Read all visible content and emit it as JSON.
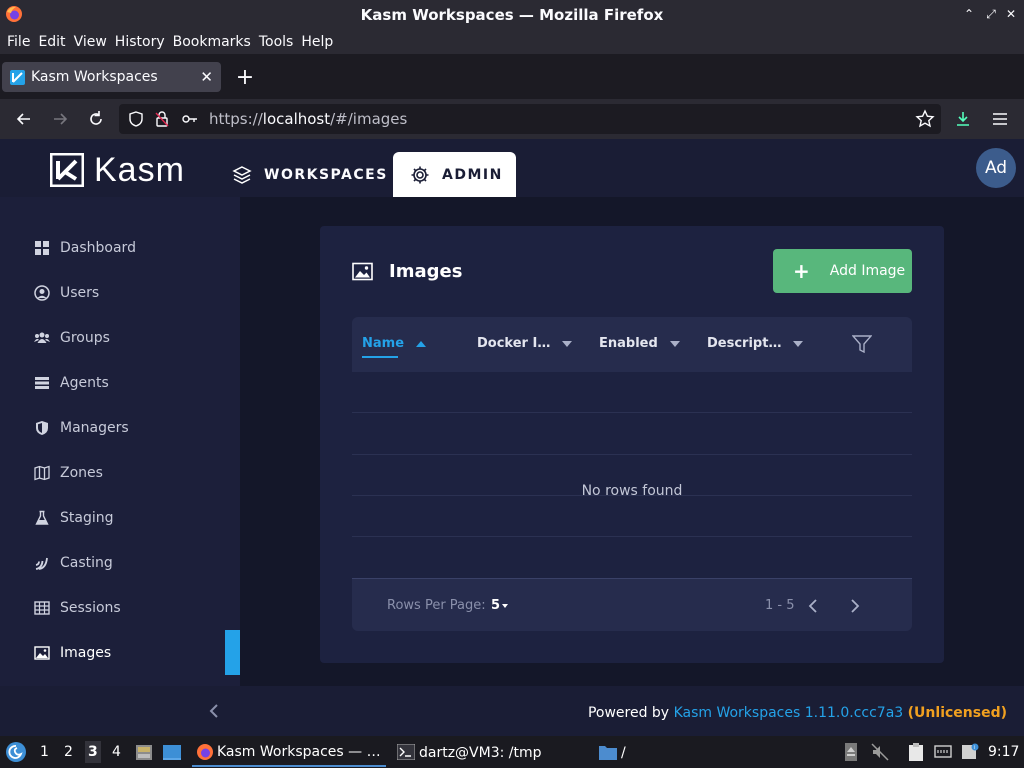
{
  "window": {
    "title": "Kasm Workspaces — Mozilla Firefox"
  },
  "menubar": {
    "items": [
      "File",
      "Edit",
      "View",
      "History",
      "Bookmarks",
      "Tools",
      "Help"
    ]
  },
  "tab": {
    "label": "Kasm Workspaces"
  },
  "url": {
    "prefix": "https://",
    "host": "localhost",
    "path": "/#/images"
  },
  "app": {
    "logo_text": "Kasm",
    "nav": {
      "workspaces": "WORKSPACES",
      "admin": "ADMIN"
    },
    "avatar": "Ad",
    "sidebar": {
      "items": [
        {
          "label": "Dashboard",
          "icon": "dashboard-icon"
        },
        {
          "label": "Users",
          "icon": "user-circle-icon"
        },
        {
          "label": "Groups",
          "icon": "users-icon"
        },
        {
          "label": "Agents",
          "icon": "server-icon"
        },
        {
          "label": "Managers",
          "icon": "shield-icon"
        },
        {
          "label": "Zones",
          "icon": "map-icon"
        },
        {
          "label": "Staging",
          "icon": "flask-icon"
        },
        {
          "label": "Casting",
          "icon": "cast-icon"
        },
        {
          "label": "Sessions",
          "icon": "table-icon"
        },
        {
          "label": "Images",
          "icon": "image-icon"
        }
      ],
      "active": "Images"
    },
    "card": {
      "title": "Images",
      "add_button": "Add Image",
      "columns": [
        "Name",
        "Docker I…",
        "Enabled",
        "Descript…"
      ],
      "sort_column": "Name",
      "empty_text": "No rows found",
      "rows_per_page_label": "Rows Per Page:",
      "rows_per_page": "5",
      "page_range": "1 - 5"
    },
    "footer": {
      "prefix": "Powered by",
      "link": "Kasm Workspaces 1.11.0.ccc7a3",
      "license": "(Unlicensed)"
    }
  },
  "taskbar": {
    "workspaces": [
      "1",
      "2",
      "3",
      "4"
    ],
    "active_workspace": "3",
    "tasks": {
      "firefox": "Kasm Workspaces — …",
      "terminal": "dartz@VM3: /tmp",
      "files": "/"
    },
    "clock": "9:17"
  },
  "colors": {
    "accent": "#24a2e8",
    "add_button": "#58b77c",
    "unlicensed": "#f0a020"
  }
}
